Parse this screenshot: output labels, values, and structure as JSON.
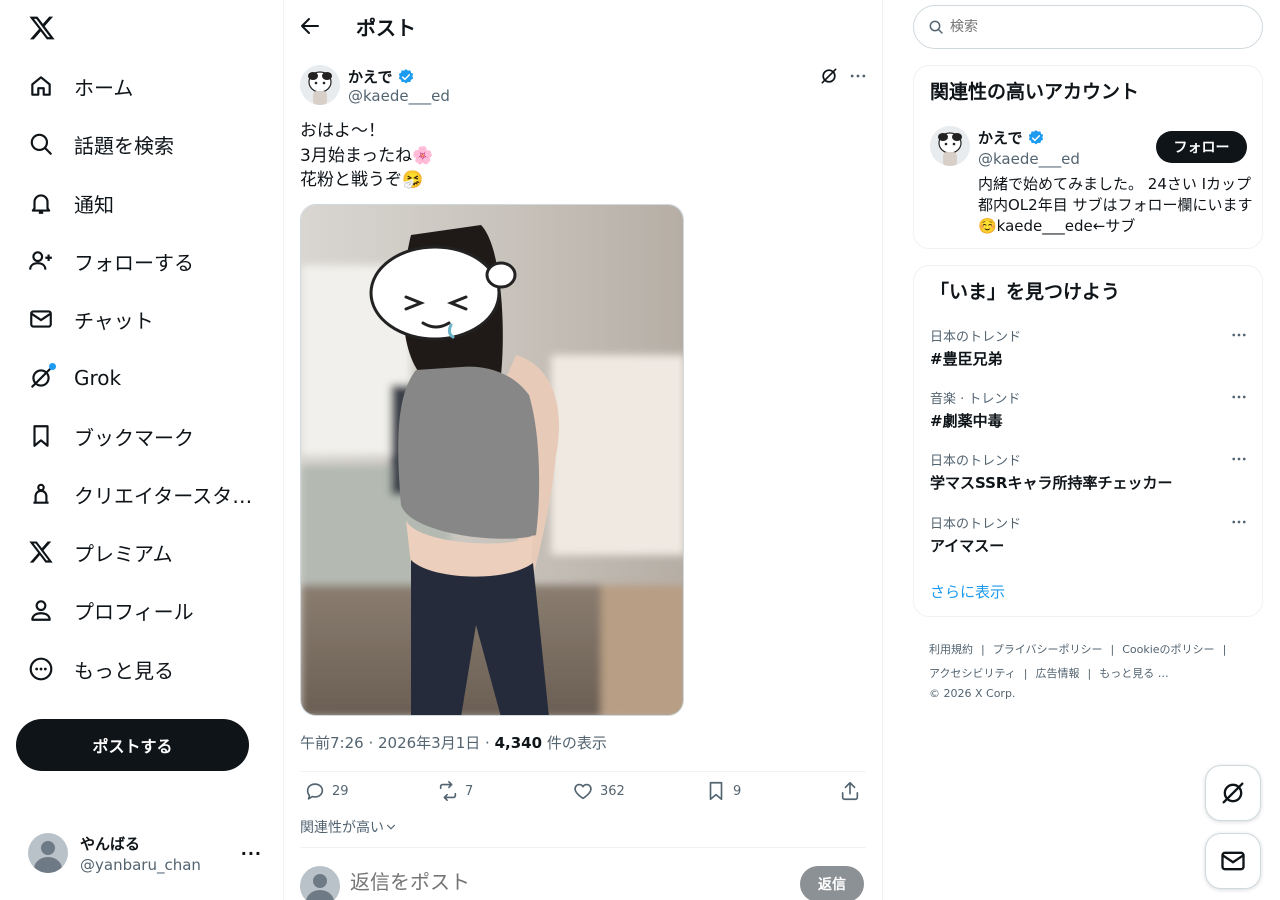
{
  "nav": {
    "items": [
      {
        "label": "ホーム",
        "icon": "home-icon"
      },
      {
        "label": "話題を検索",
        "icon": "search-icon"
      },
      {
        "label": "通知",
        "icon": "bell-icon"
      },
      {
        "label": "フォローする",
        "icon": "add-user-icon"
      },
      {
        "label": "チャット",
        "icon": "mail-icon"
      },
      {
        "label": "Grok",
        "icon": "grok-icon"
      },
      {
        "label": "ブックマーク",
        "icon": "bookmark-icon"
      },
      {
        "label": "クリエイタースタ…",
        "icon": "creator-icon"
      },
      {
        "label": "プレミアム",
        "icon": "x-icon"
      },
      {
        "label": "プロフィール",
        "icon": "user-icon"
      },
      {
        "label": "もっと見る",
        "icon": "more-circle-icon"
      }
    ],
    "post_button": "ポストする"
  },
  "account": {
    "name": "やんばる",
    "handle": "@yanbaru_chan"
  },
  "header": {
    "title": "ポスト"
  },
  "tweet": {
    "author_name": "かえで",
    "author_handle": "@kaede___ed",
    "text_lines": [
      "おはよ〜！",
      "3月始まったね🌸",
      "花粉と戦うぞ🤧"
    ],
    "time": "午前7:26",
    "date": "2026年3月1日",
    "views": "4,340",
    "views_label": "件の表示",
    "replies": "29",
    "retweets": "7",
    "likes": "362",
    "bookmarks": "9",
    "sort_label": "関連性が高い"
  },
  "reply": {
    "placeholder": "返信をポスト",
    "button": "返信"
  },
  "search": {
    "placeholder": "検索"
  },
  "related": {
    "title": "関連性の高いアカウント",
    "name": "かえで",
    "handle": "@kaede___ed",
    "follow": "フォロー",
    "bio": "内緒で始めてみました。 24さい Iカップ 都内OL2年目 サブはフォロー欄にいます☺️kaede___ede←サブ"
  },
  "trends": {
    "title": "「いま」を見つけよう",
    "items": [
      {
        "category": "日本のトレンド",
        "name": "#豊臣兄弟"
      },
      {
        "category": "音楽 · トレンド",
        "name": "#劇薬中毒"
      },
      {
        "category": "日本のトレンド",
        "name": "学マスSSRキャラ所持率チェッカー"
      },
      {
        "category": "日本のトレンド",
        "name": "アイマスー"
      }
    ],
    "show_more": "さらに表示"
  },
  "footer": {
    "links": [
      "利用規約",
      "プライバシーポリシー",
      "Cookieのポリシー",
      "アクセシビリティ",
      "広告情報",
      "もっと見る …"
    ],
    "copyright": "© 2026 X Corp."
  },
  "colors": {
    "accent": "#1d9bf0",
    "text": "#0f1419",
    "muted": "#536471",
    "button_dark": "#0f1419"
  }
}
